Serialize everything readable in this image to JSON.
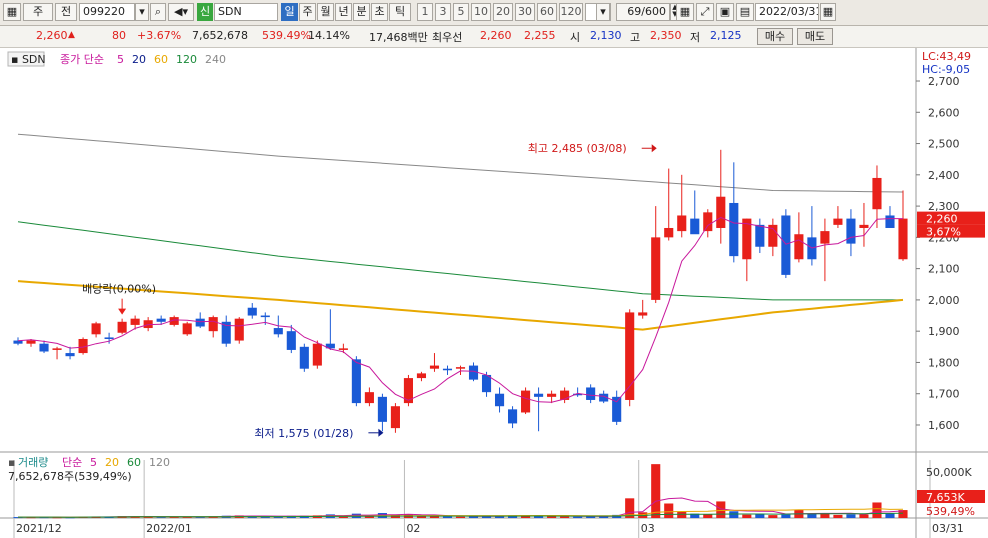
{
  "toolbar": {
    "market": "주",
    "market2": "전",
    "code": "099220",
    "name": "SDN",
    "credit_badge": "신",
    "periods": [
      "일",
      "주",
      "월",
      "년",
      "분",
      "초",
      "틱"
    ],
    "active_period": "일",
    "intervals": [
      "1",
      "3",
      "5",
      "10",
      "20",
      "30",
      "60",
      "120"
    ],
    "count": "69/600",
    "date": "2022/03/31"
  },
  "quote": {
    "price": "2,260",
    "change": "80",
    "change_pct": "+3.67%",
    "volume": "7,652,678",
    "volume_ratio": "539.49%",
    "turnover": "14.14%",
    "amount": "17,468백만",
    "best_label": "최우선",
    "ask": "2,260",
    "bid": "2,255",
    "open_label": "시",
    "open": "2,130",
    "high_label": "고",
    "high": "2,350",
    "low_label": "저",
    "low": "2,125",
    "buy_label": "매수",
    "sell_label": "매도"
  },
  "chart_data": {
    "type": "candlestick",
    "symbol": "SDN",
    "price_legend": {
      "label": "종가 단순",
      "periods": [
        "5",
        "20",
        "60",
        "120",
        "240"
      ],
      "colors": [
        "#c8189c",
        "#0a1c8a",
        "#e8a800",
        "#1a8a3a",
        "#888888"
      ]
    },
    "volume_legend": {
      "title": "거래량",
      "label": "단순",
      "periods": [
        "5",
        "20",
        "60",
        "120"
      ],
      "colors": [
        "#c8189c",
        "#e8a800",
        "#1a8a3a",
        "#888888"
      ]
    },
    "volume_info": "7,652,678주(539,49%)",
    "lc": "LC:43,49",
    "hc": "HC:-9,05",
    "y_ticks": [
      1600,
      1700,
      1800,
      1900,
      2000,
      2100,
      2200,
      2300,
      2400,
      2500,
      2600,
      2700
    ],
    "y_tick_labels": [
      "1,600",
      "1,700",
      "1,800",
      "1,900",
      "2,000",
      "2,100",
      "2,200",
      "2,300",
      "2,400",
      "2,500",
      "2,600",
      "2,700"
    ],
    "ylim": [
      1520,
      2780
    ],
    "vol_tick_label": "50,000K",
    "vol_ylim": [
      0,
      56000
    ],
    "last_price_label": "2,260",
    "last_pct_label": "3,67%",
    "last_vol_label": "7,653K",
    "last_vol_pct_label": "539,49%",
    "x_labels": [
      {
        "i": 0,
        "text": "2021/12"
      },
      {
        "i": 10,
        "text": "2022/01"
      },
      {
        "i": 30,
        "text": "02"
      },
      {
        "i": 48,
        "text": "03"
      },
      {
        "i": 68,
        "text": "03/31"
      }
    ],
    "annotations": [
      {
        "i": 49,
        "text": "최고 2,485 (03/08)",
        "value": 2485,
        "dir": "right"
      },
      {
        "i": 28,
        "text": "최저 1,575 (01/28)",
        "value": 1575,
        "dir": "right"
      },
      {
        "i": 8,
        "text": "배당락(0,00%)",
        "value": 1940,
        "dir": "down"
      }
    ],
    "candles": [
      [
        1870,
        1880,
        1855,
        1860,
        900
      ],
      [
        1860,
        1875,
        1850,
        1870,
        800
      ],
      [
        1860,
        1870,
        1830,
        1835,
        850
      ],
      [
        1840,
        1850,
        1810,
        1845,
        750
      ],
      [
        1830,
        1850,
        1810,
        1820,
        700
      ],
      [
        1830,
        1880,
        1825,
        1875,
        1200
      ],
      [
        1890,
        1930,
        1880,
        1925,
        1500
      ],
      [
        1880,
        1895,
        1860,
        1875,
        1100
      ],
      [
        1895,
        1940,
        1890,
        1930,
        1800
      ],
      [
        1920,
        1950,
        1905,
        1940,
        1600
      ],
      [
        1910,
        1945,
        1900,
        1935,
        1200
      ],
      [
        1940,
        1950,
        1920,
        1930,
        1100
      ],
      [
        1920,
        1950,
        1915,
        1945,
        1000
      ],
      [
        1890,
        1930,
        1885,
        1925,
        1300
      ],
      [
        1940,
        1960,
        1910,
        1915,
        1400
      ],
      [
        1900,
        1950,
        1880,
        1945,
        1700
      ],
      [
        1930,
        1950,
        1850,
        1860,
        2200
      ],
      [
        1870,
        1945,
        1860,
        1940,
        2500
      ],
      [
        1975,
        1990,
        1940,
        1950,
        1800
      ],
      [
        1950,
        1960,
        1920,
        1945,
        1300
      ],
      [
        1910,
        1950,
        1880,
        1890,
        1500
      ],
      [
        1900,
        1920,
        1830,
        1840,
        2100
      ],
      [
        1850,
        1860,
        1770,
        1780,
        2300
      ],
      [
        1790,
        1870,
        1780,
        1860,
        2600
      ],
      [
        1860,
        1970,
        1840,
        1845,
        3500
      ],
      [
        1840,
        1860,
        1830,
        1845,
        1200
      ],
      [
        1810,
        1820,
        1660,
        1670,
        4200
      ],
      [
        1670,
        1720,
        1660,
        1705,
        2300
      ],
      [
        1690,
        1700,
        1580,
        1610,
        4800
      ],
      [
        1590,
        1670,
        1575,
        1660,
        3100
      ],
      [
        1670,
        1760,
        1660,
        1750,
        3400
      ],
      [
        1750,
        1770,
        1740,
        1765,
        1800
      ],
      [
        1780,
        1830,
        1770,
        1790,
        2000
      ],
      [
        1780,
        1790,
        1760,
        1775,
        1400
      ],
      [
        1780,
        1790,
        1760,
        1785,
        1300
      ],
      [
        1790,
        1800,
        1740,
        1745,
        1700
      ],
      [
        1760,
        1770,
        1690,
        1705,
        2000
      ],
      [
        1700,
        1720,
        1640,
        1660,
        2200
      ],
      [
        1650,
        1660,
        1590,
        1605,
        2600
      ],
      [
        1640,
        1720,
        1635,
        1710,
        2400
      ],
      [
        1700,
        1720,
        1580,
        1690,
        2200
      ],
      [
        1690,
        1710,
        1670,
        1700,
        1500
      ],
      [
        1680,
        1720,
        1670,
        1710,
        1400
      ],
      [
        1700,
        1720,
        1690,
        1695,
        1300
      ],
      [
        1720,
        1730,
        1670,
        1680,
        1800
      ],
      [
        1700,
        1710,
        1670,
        1675,
        1700
      ],
      [
        1690,
        1710,
        1600,
        1610,
        3000
      ],
      [
        1680,
        1970,
        1660,
        1960,
        19000
      ],
      [
        1950,
        2000,
        1940,
        1960,
        5500
      ],
      [
        2000,
        2300,
        1990,
        2200,
        52000
      ],
      [
        2200,
        2420,
        2190,
        2230,
        14000
      ],
      [
        2220,
        2400,
        2200,
        2270,
        6000
      ],
      [
        2260,
        2350,
        2220,
        2210,
        4200
      ],
      [
        2220,
        2290,
        2200,
        2280,
        3800
      ],
      [
        2230,
        2480,
        2180,
        2330,
        16000
      ],
      [
        2310,
        2440,
        2120,
        2140,
        6500
      ],
      [
        2130,
        2260,
        2060,
        2260,
        3200
      ],
      [
        2240,
        2260,
        2150,
        2170,
        3500
      ],
      [
        2170,
        2260,
        2140,
        2240,
        2800
      ],
      [
        2270,
        2290,
        2070,
        2080,
        3300
      ],
      [
        2130,
        2280,
        2120,
        2210,
        8000
      ],
      [
        2200,
        2300,
        2110,
        2130,
        3900
      ],
      [
        2180,
        2260,
        2060,
        2220,
        4100
      ],
      [
        2240,
        2300,
        2230,
        2260,
        3000
      ],
      [
        2260,
        2290,
        2140,
        2180,
        3600
      ],
      [
        2230,
        2310,
        2170,
        2240,
        3400
      ],
      [
        2290,
        2430,
        2230,
        2390,
        15000
      ],
      [
        2270,
        2300,
        2230,
        2230,
        4700
      ],
      [
        2130,
        2350,
        2125,
        2260,
        7653
      ]
    ],
    "ma": {
      "ma5_dec": [
        1860,
        1860,
        1855,
        1850,
        1846,
        1845,
        1852,
        1862,
        1878,
        1894
      ],
      "ma20_dec": [
        1865,
        1864,
        1862,
        1860,
        1859,
        1860,
        1865,
        1870,
        1878,
        1885
      ],
      "ma60": [
        [
          0,
          2060
        ],
        [
          20,
          2000
        ],
        [
          48,
          1905
        ],
        [
          58,
          1960
        ],
        [
          68,
          2000
        ]
      ],
      "ma120": [
        [
          0,
          2250
        ],
        [
          20,
          2140
        ],
        [
          48,
          2020
        ],
        [
          58,
          2000
        ],
        [
          68,
          2000
        ]
      ],
      "ma240": [
        [
          0,
          2530
        ],
        [
          20,
          2460
        ],
        [
          48,
          2380
        ],
        [
          58,
          2350
        ],
        [
          68,
          2345
        ]
      ]
    }
  }
}
